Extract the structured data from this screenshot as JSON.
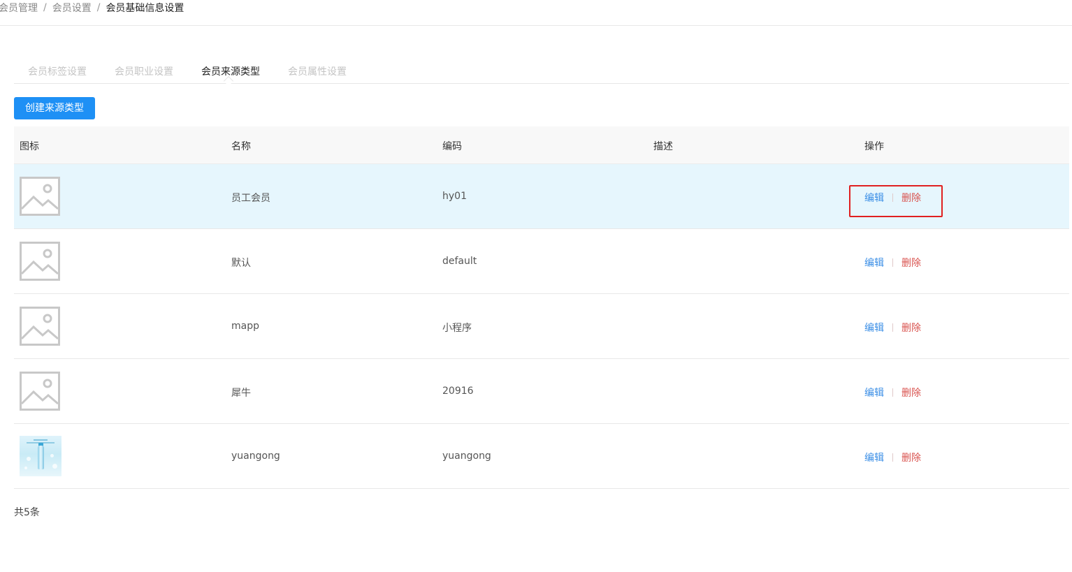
{
  "breadcrumb": {
    "items": [
      "会员管理",
      "会员设置",
      "会员基础信息设置"
    ],
    "separator": "/"
  },
  "tabs": [
    {
      "label": "会员标签设置",
      "active": false
    },
    {
      "label": "会员职业设置",
      "active": false
    },
    {
      "label": "会员来源类型",
      "active": true
    },
    {
      "label": "会员属性设置",
      "active": false
    }
  ],
  "create_button": {
    "label": "创建来源类型"
  },
  "table": {
    "columns": [
      "图标",
      "名称",
      "编码",
      "描述",
      "操作"
    ],
    "rows": [
      {
        "icon": "image-placeholder-icon",
        "name": "员工会员",
        "code": "hy01",
        "description": "",
        "edit": "编辑",
        "delete": "删除",
        "highlighted": true
      },
      {
        "icon": "image-placeholder-icon",
        "name": "默认",
        "code": "default",
        "description": "",
        "edit": "编辑",
        "delete": "删除",
        "highlighted": false
      },
      {
        "icon": "image-placeholder-icon",
        "name": "mapp",
        "code": "小程序",
        "description": "",
        "edit": "编辑",
        "delete": "删除",
        "highlighted": false
      },
      {
        "icon": "image-placeholder-icon",
        "name": "犀牛",
        "code": "20916",
        "description": "",
        "edit": "编辑",
        "delete": "删除",
        "highlighted": false
      },
      {
        "icon": "water-bottle-thumbnail",
        "name": "yuangong",
        "code": "yuangong",
        "description": "",
        "edit": "编辑",
        "delete": "删除",
        "highlighted": false
      }
    ]
  },
  "total_text": "共5条",
  "colors": {
    "primary": "#1e90f5",
    "edit_link": "#3a8ee6",
    "delete_link": "#d9534f",
    "row_highlight": "#e6f6fd",
    "annotation_box": "#e02020"
  }
}
